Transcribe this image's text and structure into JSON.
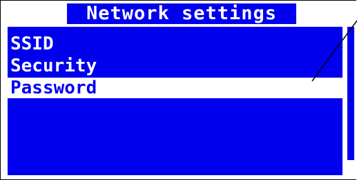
{
  "screen": {
    "title": "Network settings",
    "menu_items": [
      {
        "label": "SSID"
      },
      {
        "label": "Security"
      },
      {
        "label": "Password",
        "selected": true
      }
    ],
    "scrollbar": {
      "position_fraction": 0.0,
      "visible_fraction": 0.9
    }
  },
  "colors": {
    "background": "#ffffff",
    "accent": "#0000ee",
    "text_on_accent": "#ffffff"
  }
}
